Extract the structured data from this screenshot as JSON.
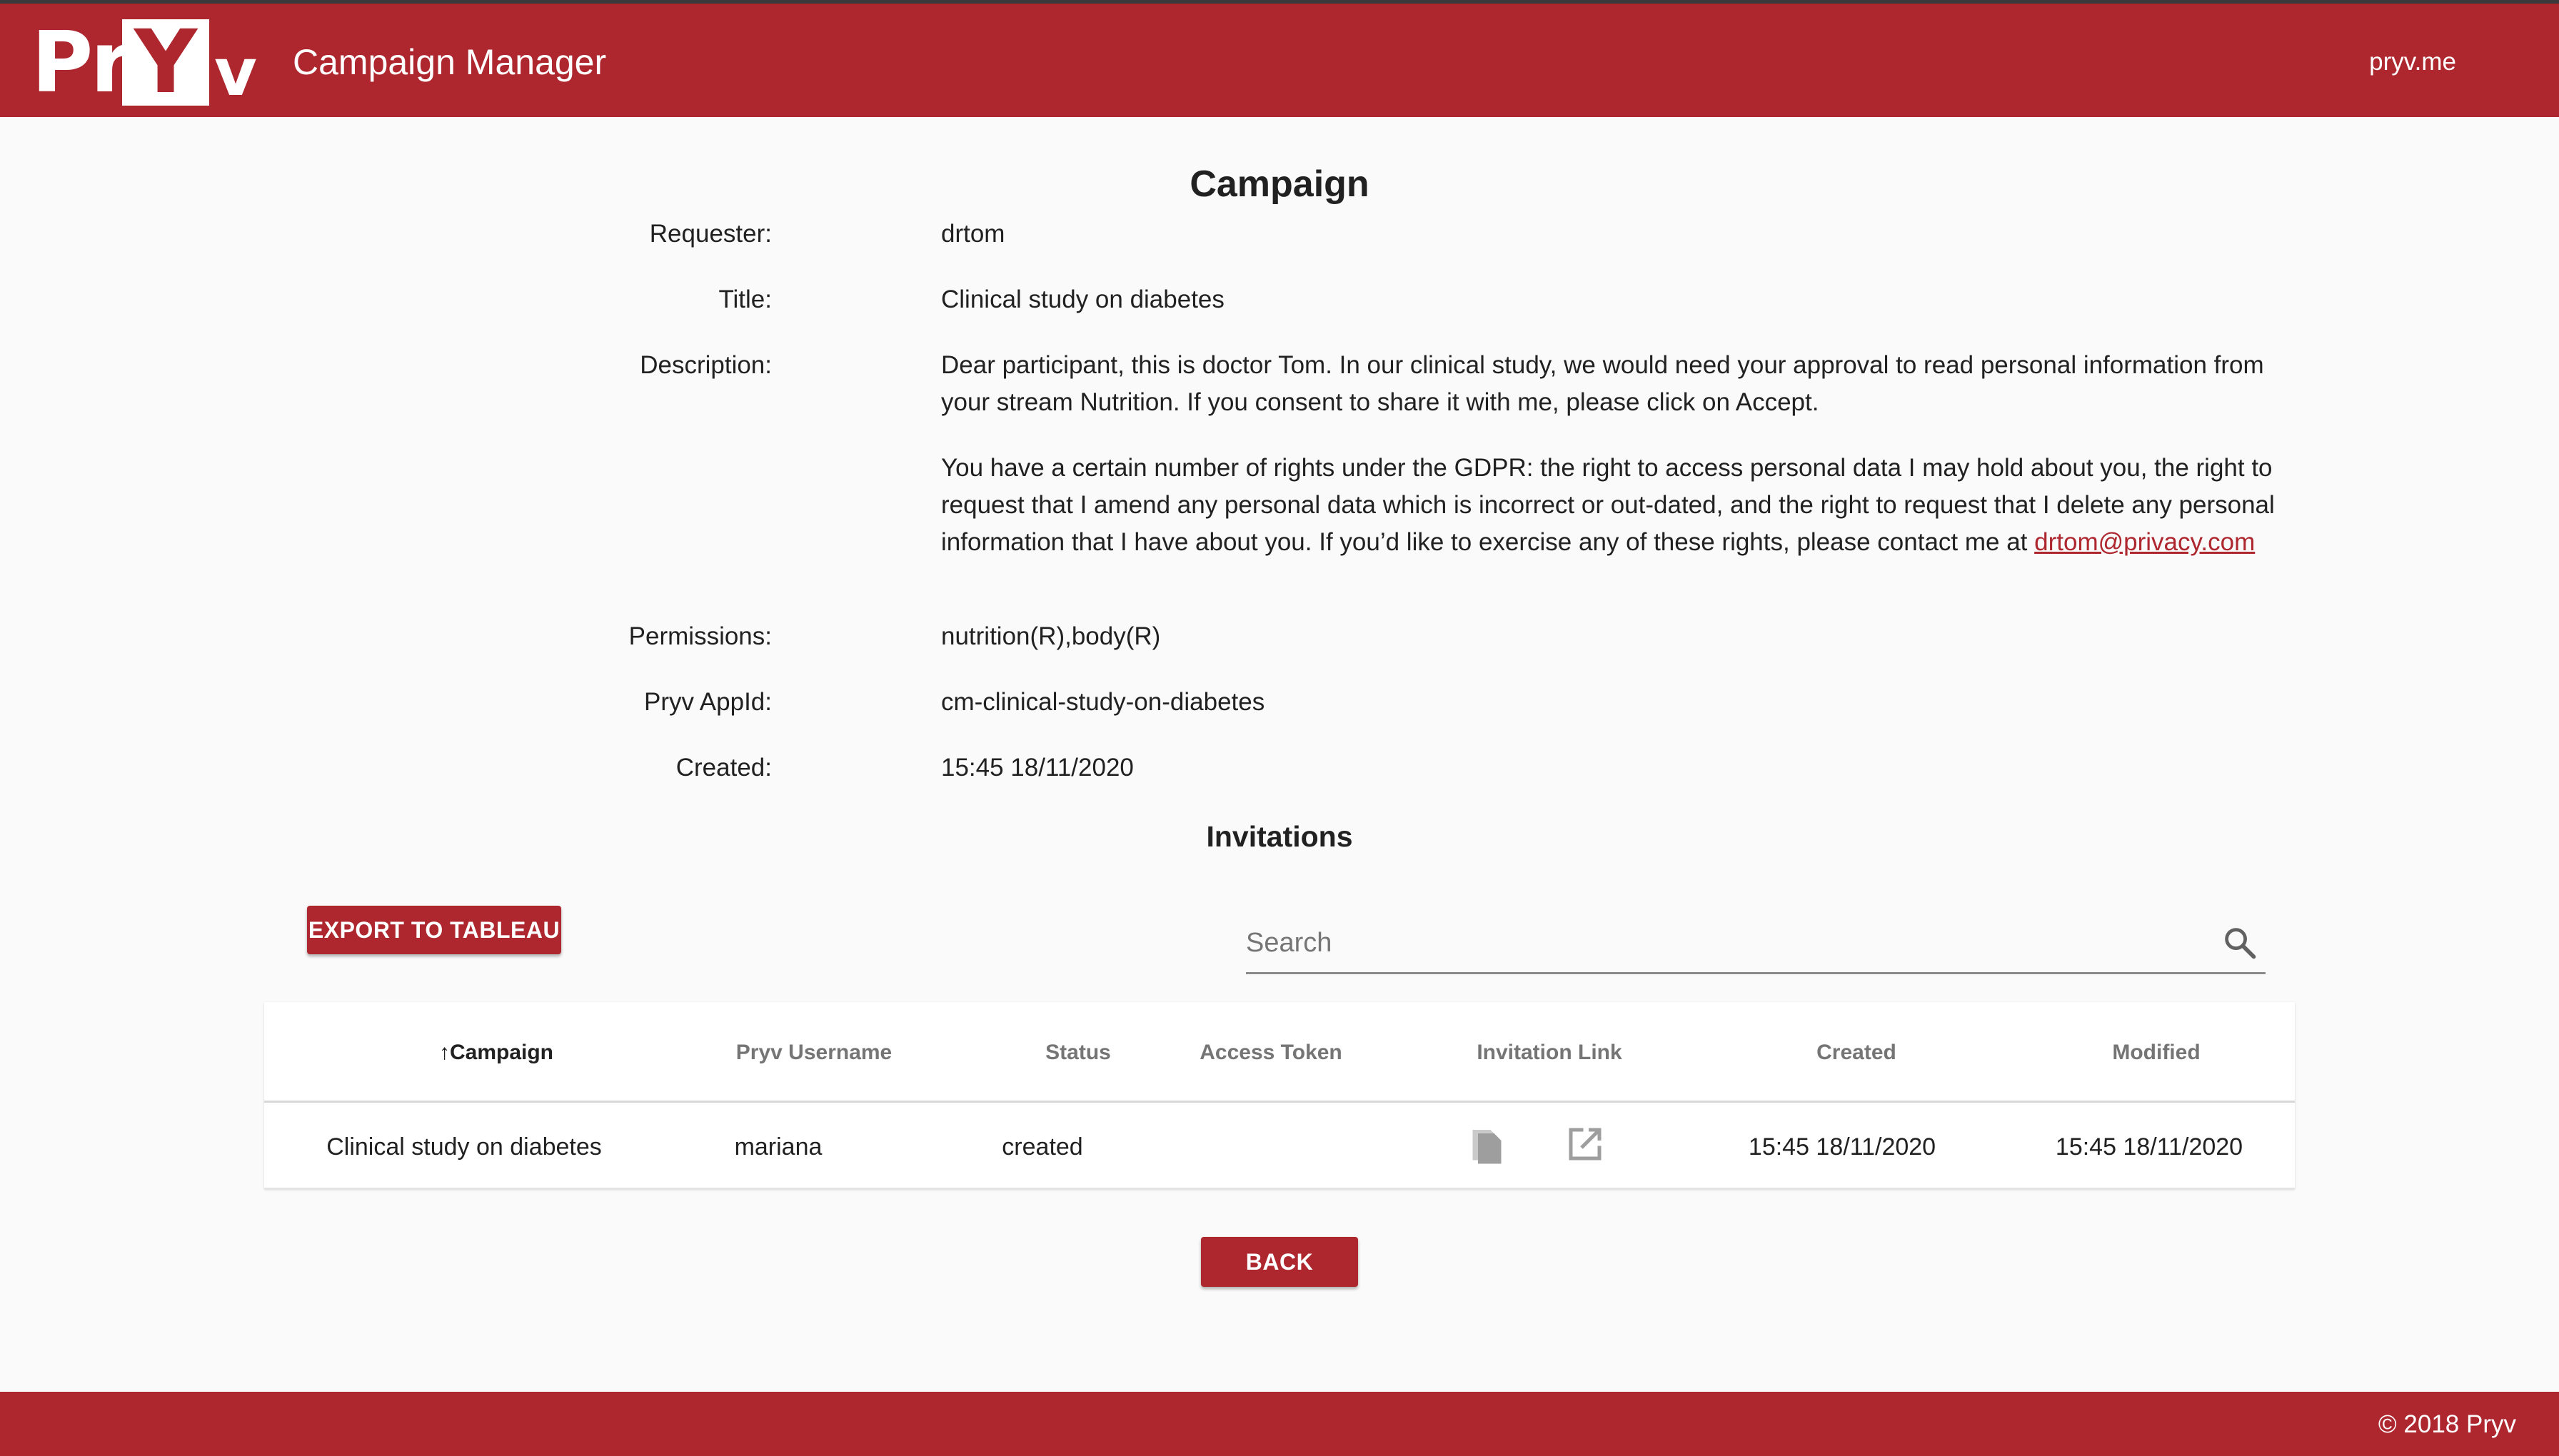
{
  "header": {
    "logo_text": "PrYv",
    "app_title": "Campaign Manager",
    "link": "pryv.me"
  },
  "campaign": {
    "title": "Campaign",
    "fields": {
      "requester": {
        "label": "Requester:",
        "value": "drtom"
      },
      "title": {
        "label": "Title:",
        "value": "Clinical study on diabetes"
      },
      "description": {
        "label": "Description:",
        "paragraph1": "Dear participant, this is doctor Tom. In our clinical study, we would need your approval to read personal information from your stream Nutrition. If you consent to share it with me, please click on Accept.",
        "paragraph2": "You have a certain number of rights under the GDPR: the right to access personal data I may hold about you, the right to request that I amend any personal data which is incorrect or out-dated, and the right to request that I delete any personal information that I have about you. If you’d like to exercise any of these rights, please contact me at",
        "email": "drtom@privacy.com"
      },
      "permissions": {
        "label": "Permissions:",
        "value": "nutrition(R),body(R)"
      },
      "appid": {
        "label": "Pryv AppId:",
        "value": "cm-clinical-study-on-diabetes"
      },
      "created": {
        "label": "Created:",
        "value": "15:45 18/11/2020"
      }
    }
  },
  "invitations": {
    "title": "Invitations",
    "export_label": "EXPORT TO TABLEAU",
    "search_placeholder": "Search",
    "columns": [
      "Campaign",
      "Pryv Username",
      "Status",
      "Access Token",
      "Invitation Link",
      "Created",
      "Modified"
    ],
    "sort_indicator": "↑",
    "rows": [
      {
        "campaign": "Clinical study on diabetes",
        "username": "mariana",
        "status": "created",
        "access_token": "",
        "link_icons": [
          "copy-icon",
          "open-in-new-icon"
        ],
        "created": "15:45 18/11/2020",
        "modified": "15:45 18/11/2020"
      }
    ],
    "back_label": "BACK"
  },
  "footer": {
    "copyright": "© 2018 Pryv"
  },
  "colors": {
    "brand": "#ae262e",
    "background": "#fafafa"
  }
}
